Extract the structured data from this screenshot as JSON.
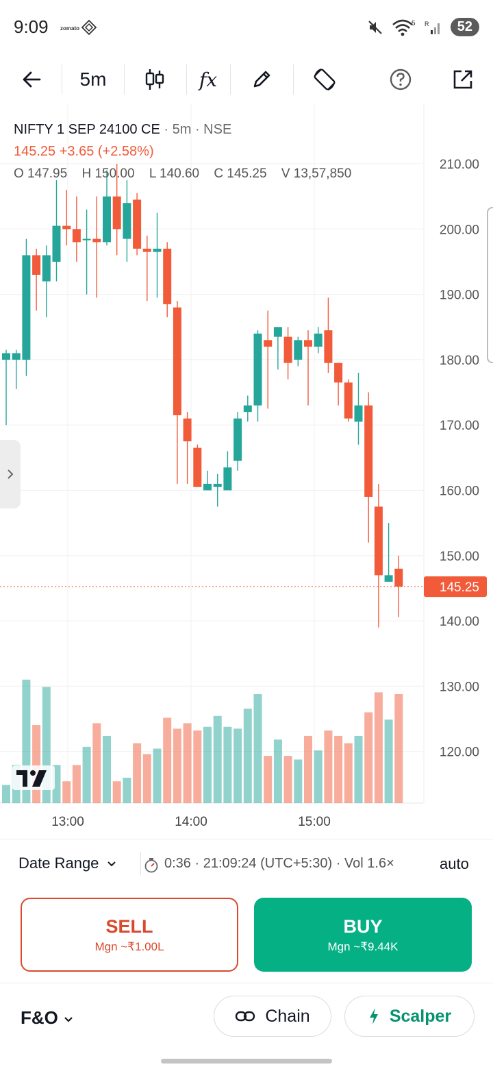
{
  "status_bar": {
    "time": "9:09",
    "app_name": "zomato",
    "signal_badge": "5",
    "roaming": "R",
    "battery": "52"
  },
  "toolbar": {
    "interval": "5m",
    "indicators_label": "fx"
  },
  "chart": {
    "symbol": "NIFTY 1 SEP 24100 CE",
    "meta": "· 5m · NSE",
    "price_change": "145.25 +3.65 (+2.58%)",
    "ohlc": {
      "open": "O 147.95",
      "high": "H 150.00",
      "low": "L 140.60",
      "close": "C 145.25",
      "volume": "V 13,57,850"
    },
    "last_price_label": "145.25",
    "up_color": "#26a69a",
    "down_color": "#f15b3a"
  },
  "chart_data": {
    "type": "candlestick",
    "ylim": [
      110,
      220
    ],
    "y_ticks": [
      "210.00",
      "200.00",
      "190.00",
      "180.00",
      "170.00",
      "160.00",
      "150.00",
      "140.00",
      "130.00",
      "120.00"
    ],
    "x_ticks": [
      "13:00",
      "14:00",
      "15:00"
    ],
    "last_price": 145.25,
    "candles": [
      {
        "o": 180.0,
        "h": 181.5,
        "l": 170.0,
        "c": 181.0
      },
      {
        "o": 180.0,
        "h": 181.5,
        "l": 175.5,
        "c": 181.0
      },
      {
        "o": 180.0,
        "h": 198.5,
        "l": 177.5,
        "c": 196.0
      },
      {
        "o": 196.0,
        "h": 197.0,
        "l": 187.5,
        "c": 193.0
      },
      {
        "o": 192.0,
        "h": 197.5,
        "l": 186.5,
        "c": 196.0
      },
      {
        "o": 195.0,
        "h": 207.5,
        "l": 192.0,
        "c": 200.5
      },
      {
        "o": 200.5,
        "h": 206.0,
        "l": 197.5,
        "c": 200.0
      },
      {
        "o": 200.0,
        "h": 205.0,
        "l": 195.0,
        "c": 198.0
      },
      {
        "o": 198.5,
        "h": 203.0,
        "l": 190.0,
        "c": 198.5
      },
      {
        "o": 198.5,
        "h": 205.0,
        "l": 189.5,
        "c": 198.0
      },
      {
        "o": 198.0,
        "h": 209.0,
        "l": 197.5,
        "c": 205.0
      },
      {
        "o": 205.0,
        "h": 210.0,
        "l": 196.0,
        "c": 200.0
      },
      {
        "o": 198.5,
        "h": 207.5,
        "l": 195.0,
        "c": 204.0
      },
      {
        "o": 204.5,
        "h": 205.5,
        "l": 196.0,
        "c": 197.0
      },
      {
        "o": 197.0,
        "h": 199.0,
        "l": 189.0,
        "c": 196.5
      },
      {
        "o": 196.5,
        "h": 202.5,
        "l": 189.5,
        "c": 197.0
      },
      {
        "o": 197.0,
        "h": 198.0,
        "l": 186.5,
        "c": 188.5
      },
      {
        "o": 188.0,
        "h": 189.0,
        "l": 161.0,
        "c": 171.5
      },
      {
        "o": 171.0,
        "h": 172.0,
        "l": 161.0,
        "c": 167.5
      },
      {
        "o": 166.5,
        "h": 167.0,
        "l": 160.5,
        "c": 160.5
      },
      {
        "o": 160.0,
        "h": 163.0,
        "l": 160.0,
        "c": 161.0
      },
      {
        "o": 160.5,
        "h": 162.5,
        "l": 157.5,
        "c": 161.0
      },
      {
        "o": 160.0,
        "h": 166.0,
        "l": 160.5,
        "c": 163.5
      },
      {
        "o": 164.5,
        "h": 172.0,
        "l": 163.0,
        "c": 171.0
      },
      {
        "o": 172.0,
        "h": 174.5,
        "l": 170.5,
        "c": 173.0
      },
      {
        "o": 173.0,
        "h": 184.5,
        "l": 170.5,
        "c": 184.0
      },
      {
        "o": 183.0,
        "h": 187.5,
        "l": 172.5,
        "c": 182.0
      },
      {
        "o": 183.5,
        "h": 185.0,
        "l": 178.5,
        "c": 185.0
      },
      {
        "o": 183.5,
        "h": 185.0,
        "l": 177.0,
        "c": 179.5
      },
      {
        "o": 180.0,
        "h": 183.5,
        "l": 179.0,
        "c": 183.0
      },
      {
        "o": 183.0,
        "h": 184.5,
        "l": 173.0,
        "c": 182.0
      },
      {
        "o": 182.0,
        "h": 185.0,
        "l": 181.0,
        "c": 184.0
      },
      {
        "o": 184.5,
        "h": 189.5,
        "l": 178.0,
        "c": 179.5
      },
      {
        "o": 179.5,
        "h": 178.5,
        "l": 173.0,
        "c": 176.5
      },
      {
        "o": 176.5,
        "h": 177.0,
        "l": 170.5,
        "c": 171.0
      },
      {
        "o": 170.5,
        "h": 178.0,
        "l": 167.0,
        "c": 173.0
      },
      {
        "o": 173.0,
        "h": 175.0,
        "l": 152.0,
        "c": 159.0
      },
      {
        "o": 157.5,
        "h": 161.0,
        "l": 139.0,
        "c": 147.0
      },
      {
        "o": 146.0,
        "h": 155.0,
        "l": 146.0,
        "c": 147.0
      },
      {
        "o": 148.0,
        "h": 150.0,
        "l": 140.6,
        "c": 145.25
      }
    ],
    "volume_relative": [
      0.1,
      0.21,
      0.68,
      0.43,
      0.64,
      0.21,
      0.12,
      0.21,
      0.31,
      0.44,
      0.37,
      0.12,
      0.14,
      0.33,
      0.27,
      0.3,
      0.47,
      0.41,
      0.44,
      0.4,
      0.42,
      0.48,
      0.42,
      0.41,
      0.52,
      0.6,
      0.26,
      0.35,
      0.26,
      0.24,
      0.37,
      0.29,
      0.4,
      0.37,
      0.33,
      0.37,
      0.5,
      0.61,
      0.46,
      0.6
    ]
  },
  "info_bar": {
    "date_range": "Date Range",
    "session_info": "0:36 · 21:09:24 (UTC+5:30) · Vol 1.6×",
    "auto": "auto"
  },
  "trade": {
    "sell_label": "SELL",
    "sell_margin": "Mgn ~₹1.00L",
    "buy_label": "BUY",
    "buy_margin": "Mgn ~₹9.44K",
    "sell_color": "#d9492b",
    "buy_color": "#05b085"
  },
  "bottom_nav": {
    "segment": "F&O",
    "chain": "Chain",
    "scalper": "Scalper"
  }
}
